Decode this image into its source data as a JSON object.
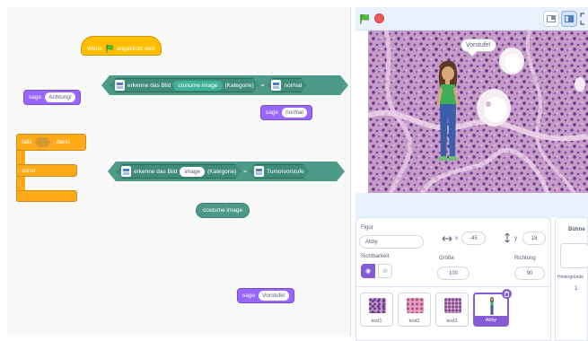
{
  "code": {
    "hat": {
      "prefix": "Wenn",
      "suffix": "angeklickt wird",
      "flag_icon": "green-flag-icon"
    },
    "say1": {
      "verb": "sage",
      "text": "Achtung!"
    },
    "classify1": {
      "label": "erkenne das Bild",
      "input": "costume image",
      "suffix": "(Kategorie)",
      "op": "=",
      "value": "normal"
    },
    "say2": {
      "verb": "sage",
      "text": "normal"
    },
    "if_else": {
      "if_label": "falls",
      "then_label": ", dann",
      "else_label": "sonst"
    },
    "classify2": {
      "label": "erkenne das Bild",
      "input": "image",
      "suffix": "(Kategorie)",
      "op": "=",
      "value": "Tumorvorstufe"
    },
    "reporter": {
      "text": "costume image"
    },
    "say3": {
      "verb": "sage",
      "text": "Vorstufe!"
    }
  },
  "stage": {
    "speech_bubble": "Vorstufe!",
    "icons": [
      "green-flag-icon",
      "stop-icon",
      "small-stage-icon",
      "normal-stage-icon",
      "fullscreen-icon"
    ]
  },
  "sprite_info": {
    "sprite_label": "Figur",
    "sprite_name": "Abby",
    "x_label": "x",
    "x_value": "-45",
    "y_label": "y",
    "y_value": "18",
    "visibility_label": "Sichtbarkeit",
    "size_label": "Größe",
    "size_value": "100",
    "direction_label": "Richtung",
    "direction_value": "90"
  },
  "sprites": [
    {
      "name": "test1",
      "selected": false
    },
    {
      "name": "test2",
      "selected": false
    },
    {
      "name": "test3",
      "selected": false
    },
    {
      "name": "Abby",
      "selected": true
    }
  ],
  "stage_pane": {
    "title": "Bühne",
    "backdrops_label": "Hintergründe",
    "backdrops_count": "1"
  },
  "colors": {
    "looks": "#9966ff",
    "events": "#ffbf00",
    "control": "#ffab19",
    "ml_extension": "#4c9a87",
    "selection": "#855cd6"
  }
}
